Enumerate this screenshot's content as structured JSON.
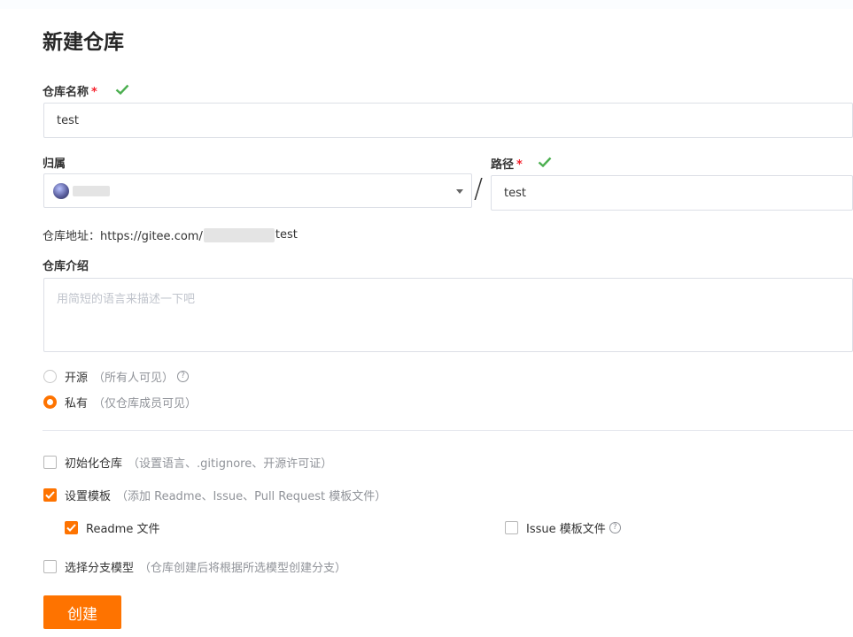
{
  "page": {
    "title": "新建仓库"
  },
  "repo_name": {
    "label": "仓库名称",
    "required_mark": "*",
    "value": "test"
  },
  "owner": {
    "label": "归属",
    "value": ""
  },
  "path": {
    "label": "路径",
    "required_mark": "*",
    "value": "test",
    "separator": "/"
  },
  "address": {
    "prefix": "仓库地址：https://gitee.com/",
    "suffix": "test"
  },
  "description": {
    "label": "仓库介绍",
    "placeholder": "用简短的语言来描述一下吧"
  },
  "visibility": {
    "options": [
      {
        "label": "开源",
        "hint": "（所有人可见）",
        "selected": false
      },
      {
        "label": "私有",
        "hint": "（仅仓库成员可见）",
        "selected": true
      }
    ]
  },
  "init_repo": {
    "label": "初始化仓库",
    "hint": "（设置语言、.gitignore、开源许可证）",
    "checked": false
  },
  "templates": {
    "label": "设置模板",
    "hint": "（添加 Readme、Issue、Pull Request 模板文件）",
    "checked": true,
    "readme": {
      "label": "Readme 文件",
      "checked": true
    },
    "issue": {
      "label": "Issue 模板文件",
      "checked": false
    }
  },
  "branch_model": {
    "label": "选择分支模型",
    "hint": "（仓库创建后将根据所选模型创建分支）",
    "checked": false
  },
  "submit": {
    "label": "创建"
  },
  "colors": {
    "accent": "#fe7300",
    "success": "#4caf50",
    "required": "#f5222d"
  }
}
